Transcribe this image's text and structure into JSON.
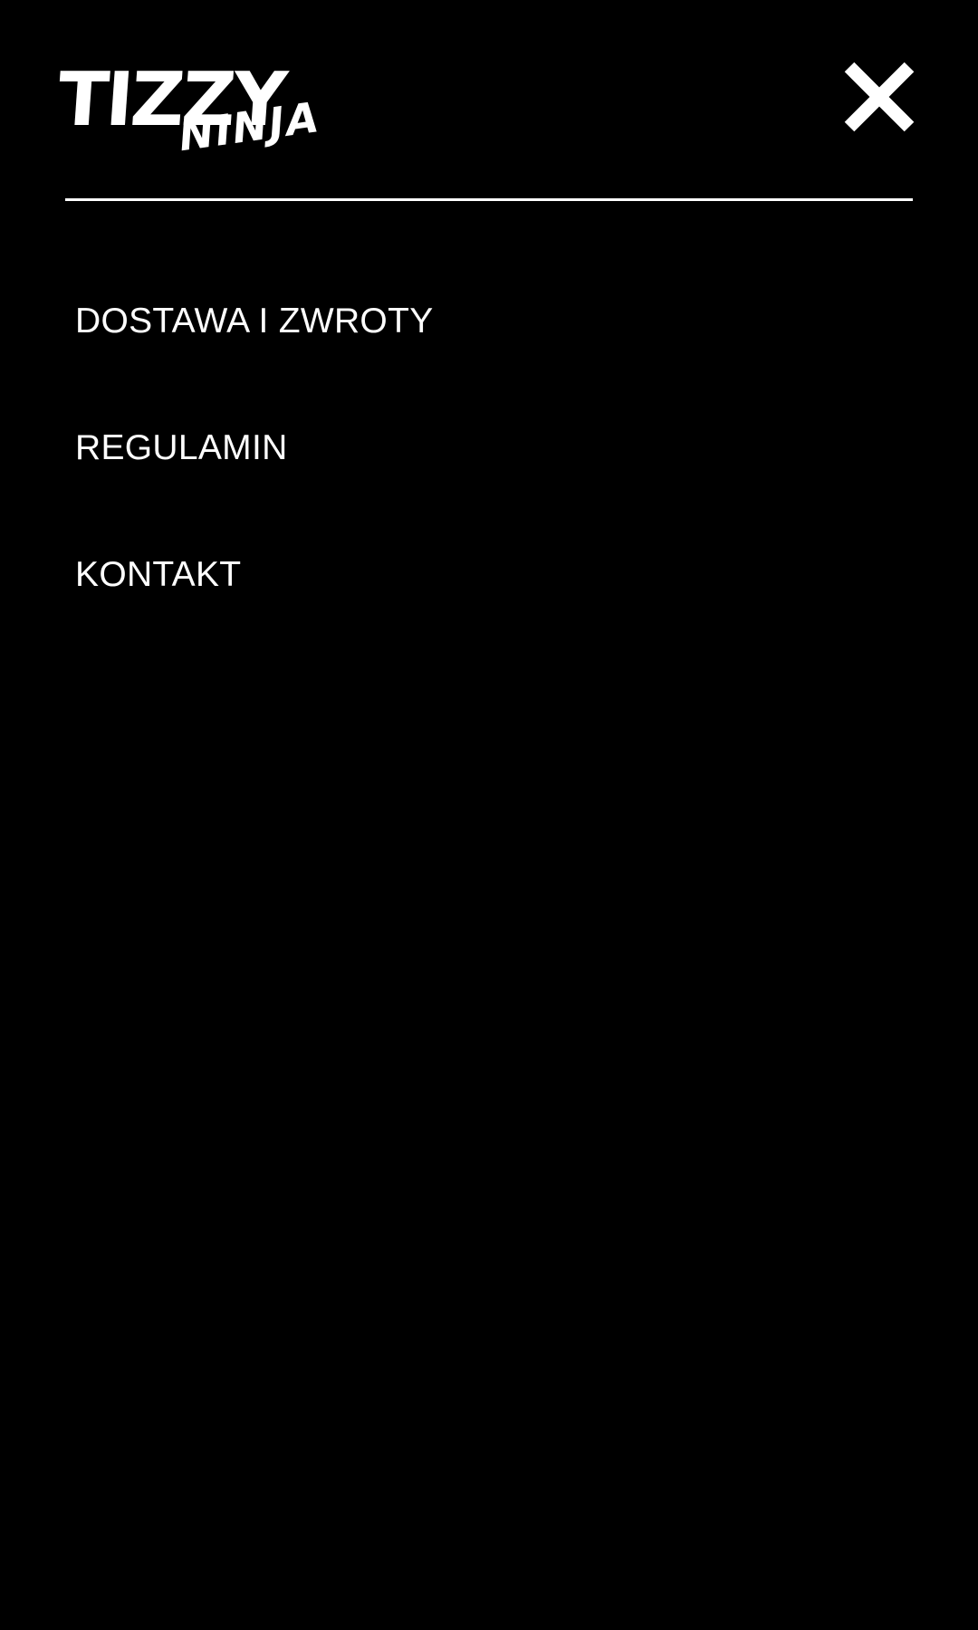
{
  "brand": {
    "logo_line1": "TIZZY",
    "logo_line2": "NINJA"
  },
  "header": {
    "close_icon": "close-icon"
  },
  "menu": {
    "items": [
      {
        "label": "DOSTAWA I ZWROTY"
      },
      {
        "label": "REGULAMIN"
      },
      {
        "label": "KONTAKT"
      }
    ]
  },
  "colors": {
    "background": "#000000",
    "foreground": "#ffffff"
  }
}
